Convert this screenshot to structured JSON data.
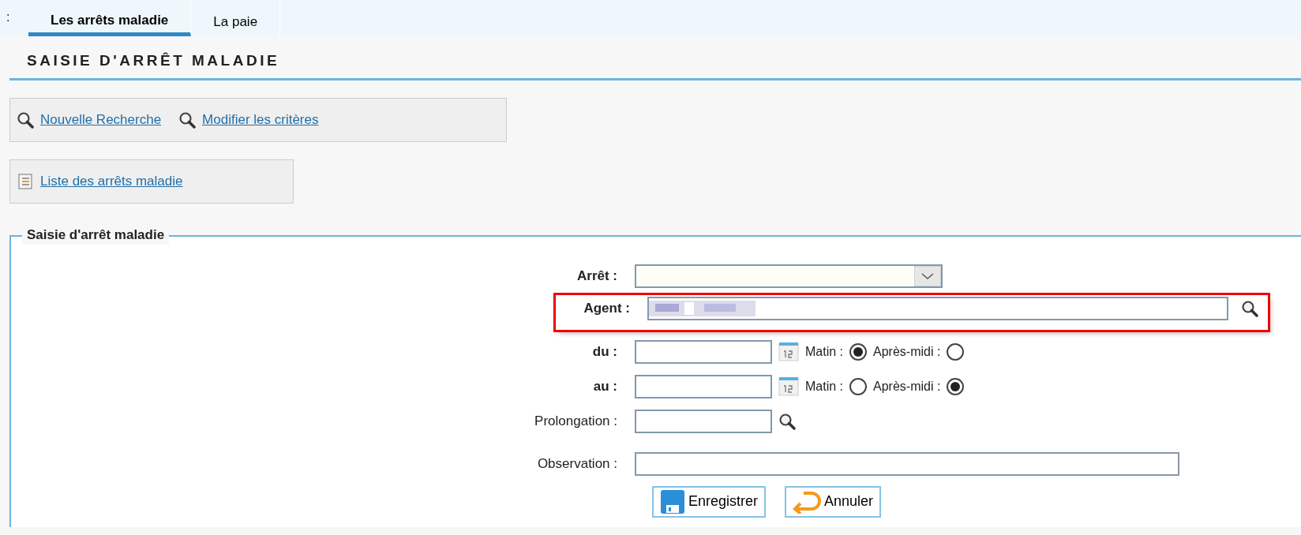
{
  "tab_bar_fragment": ":",
  "tabs": [
    {
      "label": "Les arrêts maladie",
      "selected": true
    },
    {
      "label": "La paie",
      "selected": false
    }
  ],
  "page_title": "SAISIE D'ARRÊT MALADIE",
  "action_groups": [
    [
      {
        "label": "Nouvelle Recherche",
        "kind": "search"
      },
      {
        "label": "Modifier les critères",
        "kind": "search"
      }
    ],
    [
      {
        "label": "Liste des arrêts maladie",
        "kind": "list"
      }
    ]
  ],
  "form": {
    "legend": "Saisie d'arrêt maladie",
    "fields": [
      {
        "kind": "select",
        "label": "Arrêt :",
        "bold": true
      },
      {
        "kind": "lookup",
        "label": "Agent :",
        "bold": true,
        "highlighted": true,
        "value_blurred": true
      },
      {
        "kind": "date",
        "label": "du :",
        "bold": true,
        "options": [
          {
            "label": "Matin :",
            "selected": true
          },
          {
            "label": "Après-midi :",
            "selected": false
          }
        ]
      },
      {
        "kind": "date",
        "label": "au :",
        "bold": true,
        "options": [
          {
            "label": "Matin :",
            "selected": false
          },
          {
            "label": "Après-midi :",
            "selected": true
          }
        ]
      },
      {
        "kind": "short_lookup",
        "label": "Prolongation :",
        "bold": false
      },
      {
        "kind": "text",
        "label": "Observation :",
        "bold": false
      }
    ],
    "buttons": [
      {
        "label": "Enregistrer",
        "kind": "save"
      },
      {
        "label": "Annuler",
        "kind": "undo"
      }
    ]
  }
}
